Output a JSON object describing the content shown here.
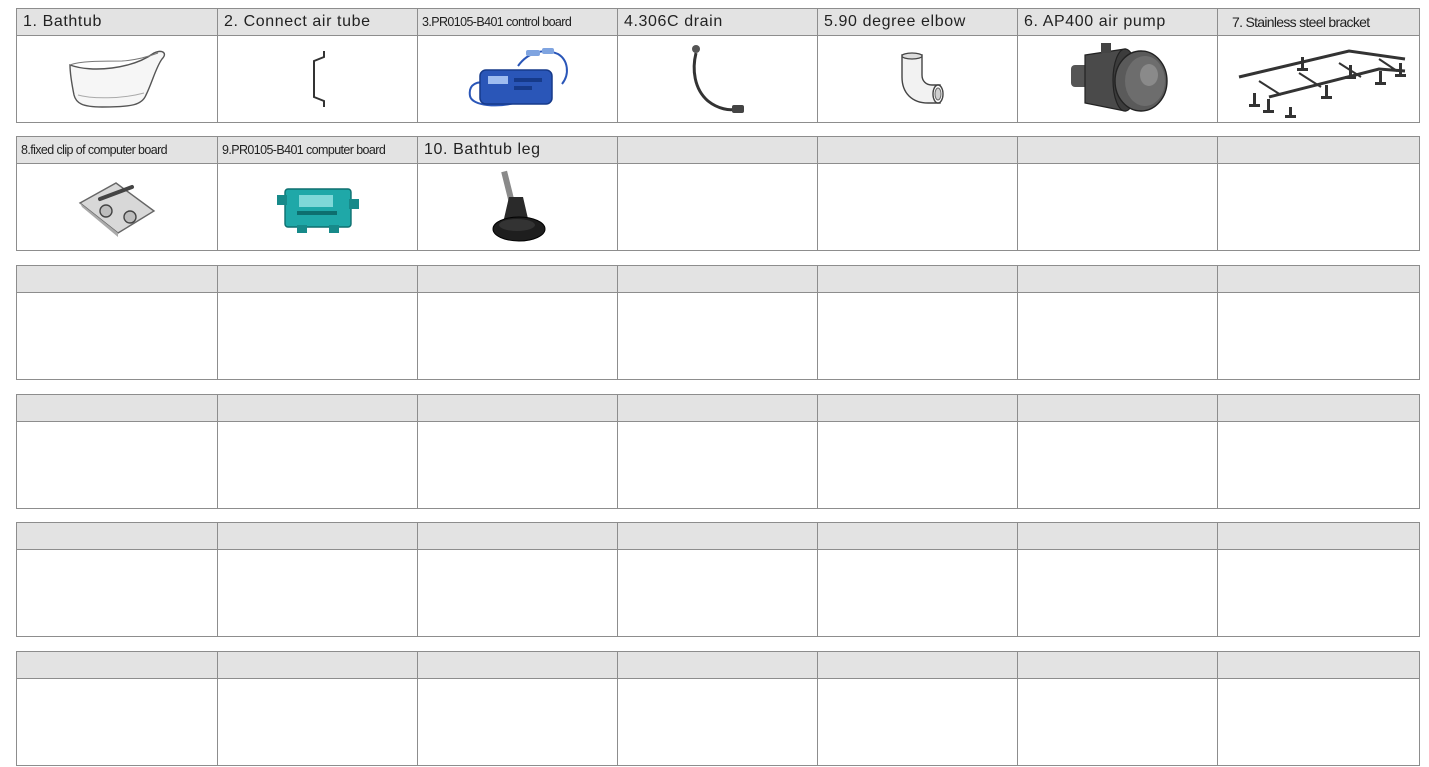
{
  "parts_table": {
    "rows": [
      {
        "headers": [
          "1. Bathtub",
          "2. Connect air tube",
          "3.PR0105-B401 control board",
          "4.306C drain",
          "5.90 degree elbow",
          "6. AP400 air pump",
          "7. Stainless steel bracket"
        ],
        "images": [
          "bathtub-icon",
          "air-tube-icon",
          "control-board-icon",
          "drain-hose-icon",
          "elbow-fitting-icon",
          "air-pump-icon",
          "bracket-frame-icon"
        ]
      },
      {
        "headers": [
          "8.fixed clip of computer board",
          "9.PR0105-B401 computer board",
          "10. Bathtub leg",
          "",
          "",
          "",
          ""
        ],
        "images": [
          "fixed-clip-icon",
          "computer-board-icon",
          "bathtub-leg-icon",
          "",
          "",
          "",
          ""
        ]
      },
      {
        "headers": [
          "",
          "",
          "",
          "",
          "",
          "",
          ""
        ],
        "images": [
          "",
          "",
          "",
          "",
          "",
          "",
          ""
        ]
      },
      {
        "headers": [
          "",
          "",
          "",
          "",
          "",
          "",
          ""
        ],
        "images": [
          "",
          "",
          "",
          "",
          "",
          "",
          ""
        ]
      },
      {
        "headers": [
          "",
          "",
          "",
          "",
          "",
          "",
          ""
        ],
        "images": [
          "",
          "",
          "",
          "",
          "",
          "",
          ""
        ]
      },
      {
        "headers": [
          "",
          "",
          "",
          "",
          "",
          "",
          ""
        ],
        "images": [
          "",
          "",
          "",
          "",
          "",
          "",
          ""
        ]
      }
    ]
  },
  "colors": {
    "header_bg": "#e3e3e3",
    "grid_line": "#8d8d8d",
    "board_blue": "#2a56b8",
    "board_teal": "#1fa8a8",
    "pump_dark": "#3c3c3c"
  }
}
